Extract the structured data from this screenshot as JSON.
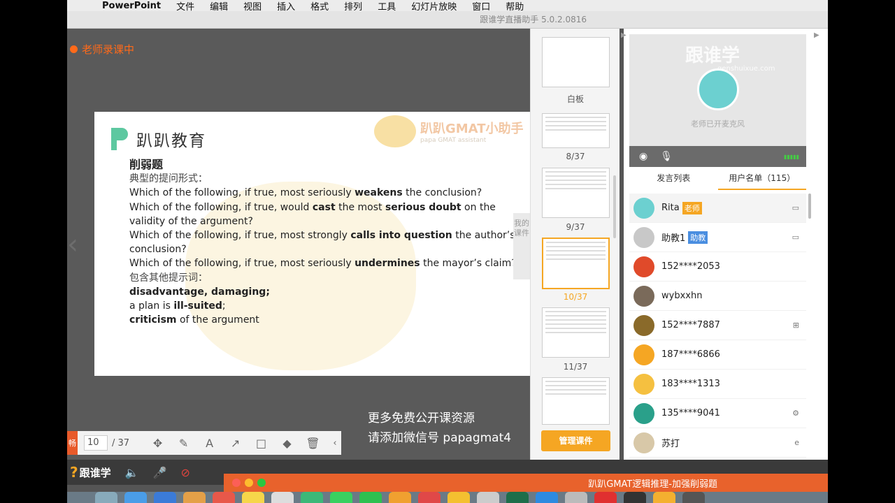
{
  "menubar": {
    "apple": "",
    "app": "PowerPoint",
    "items": [
      "文件",
      "编辑",
      "视图",
      "插入",
      "格式",
      "排列",
      "工具",
      "幻灯片放映",
      "窗口",
      "帮助"
    ]
  },
  "window_title": "跟谁学直播助手 5.0.2.0816",
  "recording_label": "老师录课中",
  "slide": {
    "logo": "趴趴教育",
    "watermark_title": "趴趴GMAT小助手",
    "watermark_sub": "papa GMAT assistant",
    "heading": "削弱题",
    "line1": "典型的提问形式：",
    "q1_pre": "Which of the following, if true, most seriously ",
    "q1_b": "weakens",
    "q1_post": " the conclusion?",
    "q2_pre": "Which of the following, if true, would ",
    "q2_b1": "cast",
    "q2_mid": " the most ",
    "q2_b2": "serious doubt",
    "q2_post": " on the validity of the argument?",
    "q3_pre": "Which of the following, if true, most strongly ",
    "q3_b": "calls into question",
    "q3_post": " the author’s conclusion?",
    "q4_pre": "Which of the following, if true, most seriously ",
    "q4_b": "undermines",
    "q4_post": " the mayor’s claim?",
    "line2": "包含其他提示词：",
    "k1": "disadvantage, damaging;",
    "k2_pre": "a plan is ",
    "k2_b": "ill-suited",
    "k2_post": ";",
    "k3_b": "criticism",
    "k3_post": " of the argument"
  },
  "toolbar": {
    "tag": "畅",
    "page": "10",
    "total": "/ 37"
  },
  "subtitle": {
    "line1": "更多免费公开课资源",
    "line2": "请添加微信号 papagmat4"
  },
  "side_tab": "我的课件",
  "thumbnails": {
    "whiteboard": "白板",
    "labels": [
      "8/37",
      "9/37",
      "10/37",
      "11/37"
    ],
    "manage": "管理课件"
  },
  "video": {
    "brand": "跟谁学",
    "url": "genshuixue.com",
    "mic_text": "老师已开麦克风"
  },
  "tabs": {
    "speak": "发言列表",
    "users": "用户名单（115）"
  },
  "users": [
    {
      "name": "Rita",
      "badge": "老师",
      "badge_color": "#f5a623",
      "device": "▭",
      "avatar": "#6cd0d0"
    },
    {
      "name": "助教1",
      "badge": "助教",
      "badge_color": "#4a8ee0",
      "device": "▭",
      "avatar": "#c8c8c8"
    },
    {
      "name": "152****2053",
      "badge": "",
      "badge_color": "",
      "device": "",
      "avatar": "#e04a2a"
    },
    {
      "name": "wybxxhn",
      "badge": "",
      "badge_color": "",
      "device": "",
      "avatar": "#7a6a5a"
    },
    {
      "name": "152****7887",
      "badge": "",
      "badge_color": "",
      "device": "⊞",
      "avatar": "#8a6a2a"
    },
    {
      "name": "187****6866",
      "badge": "",
      "badge_color": "",
      "device": "",
      "avatar": "#f5a623"
    },
    {
      "name": "183****1313",
      "badge": "",
      "badge_color": "",
      "device": "",
      "avatar": "#f5c040"
    },
    {
      "name": "135****9041",
      "badge": "",
      "badge_color": "",
      "device": "⚙",
      "avatar": "#2aa08a"
    },
    {
      "name": "苏打",
      "badge": "",
      "badge_color": "",
      "device": "e",
      "avatar": "#d8c8a8"
    }
  ],
  "appbar": {
    "logo": "跟谁学",
    "ppt_title": "趴趴GMAT逻辑推理-加强削弱题"
  }
}
